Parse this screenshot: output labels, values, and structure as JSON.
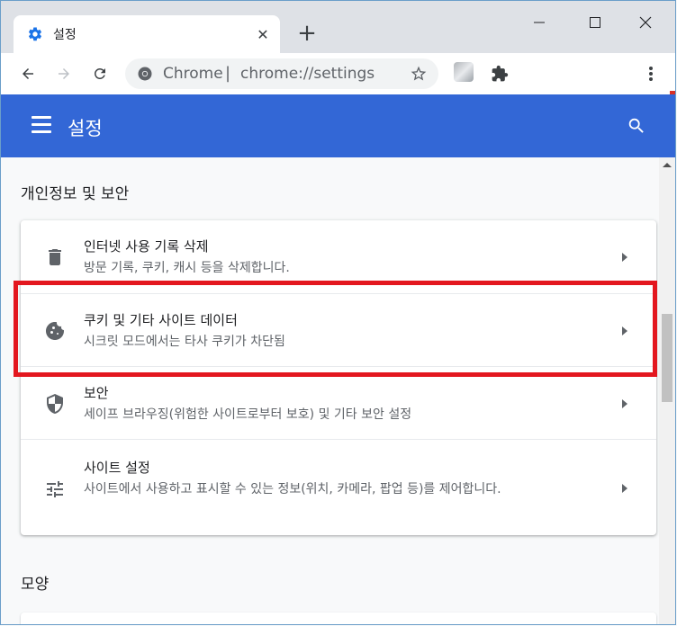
{
  "browser": {
    "tab_title": "설정",
    "tab_close": "✕",
    "new_tab": "+",
    "omnibox_chip": "Chrome",
    "omnibox_separator": "|",
    "url": "chrome://settings"
  },
  "header": {
    "title": "설정"
  },
  "privacy_section": {
    "title": "개인정보 및 보안",
    "items": [
      {
        "label": "인터넷 사용 기록 삭제",
        "sub": "방문 기록, 쿠키, 캐시 등을 삭제합니다.",
        "icon": "trash-icon"
      },
      {
        "label": "쿠키 및 기타 사이트 데이터",
        "sub": "시크릿 모드에서는 타사 쿠키가 차단됨",
        "icon": "cookie-icon"
      },
      {
        "label": "보안",
        "sub": "세이프 브라우징(위험한 사이트로부터 보호) 및 기타 보안 설정",
        "icon": "shield-icon"
      },
      {
        "label": "사이트 설정",
        "sub": "사이트에서 사용하고 표시할 수 있는 정보(위치, 카메라, 팝업 등)를 제어합니다.",
        "icon": "tune-icon"
      }
    ]
  },
  "appearance_section": {
    "title": "모양"
  },
  "colors": {
    "header_blue": "#3367d6",
    "highlight_red": "#e3171f"
  }
}
